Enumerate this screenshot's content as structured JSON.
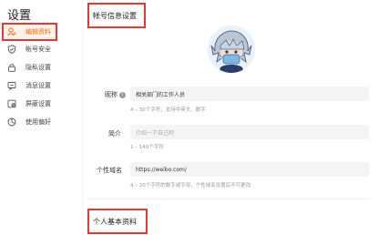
{
  "sidebar": {
    "title": "设置",
    "items": [
      {
        "label": "编辑资料",
        "icon": "user-icon",
        "active": true
      },
      {
        "label": "帐号安全",
        "icon": "shield-icon",
        "active": false
      },
      {
        "label": "隐私设置",
        "icon": "lock-icon",
        "active": false
      },
      {
        "label": "消息设置",
        "icon": "message-icon",
        "active": false
      },
      {
        "label": "屏蔽设置",
        "icon": "block-icon",
        "active": false
      },
      {
        "label": "使用偏好",
        "icon": "preference-icon",
        "active": false
      }
    ]
  },
  "main": {
    "account_section_title": "帐号信息设置",
    "nickname": {
      "label": "昵称",
      "info_icon": "i",
      "value": "相关部门的工作人员",
      "hint": "4 – 30个字符，支持中英文、数字"
    },
    "bio": {
      "label": "简介",
      "placeholder": "介绍一下自己吧",
      "hint": "1 – 140个字符"
    },
    "domain": {
      "label": "个性域名",
      "value": "https://weibo.com/",
      "hint": "4 – 20个字符的数字或字母，个性域名设置后不可更改"
    },
    "personal_section_title": "个人基本资料"
  },
  "colors": {
    "accent": "#ff6a00",
    "highlight_box": "#e53935"
  }
}
